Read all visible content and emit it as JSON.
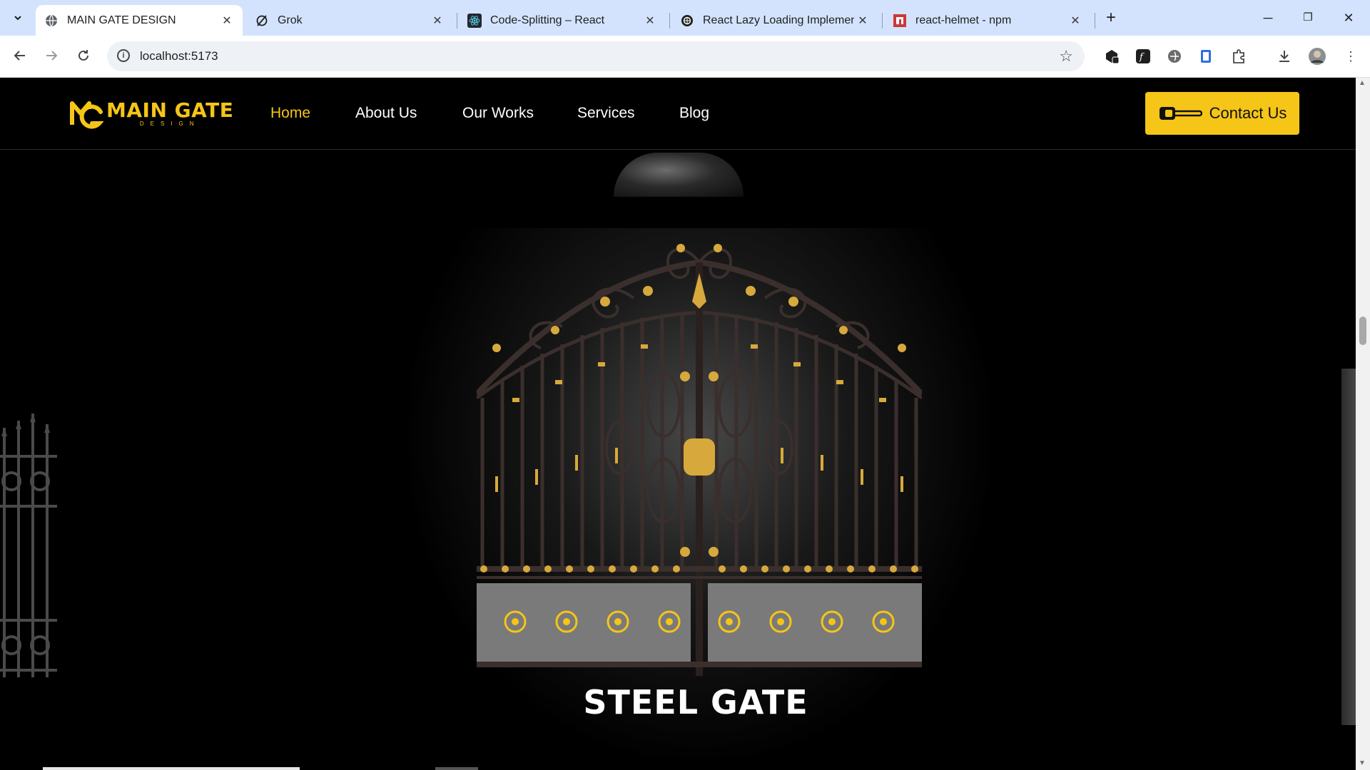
{
  "browser": {
    "tabs": [
      {
        "title": "MAIN GATE DESIGN",
        "active": true,
        "icon": "globe-icon"
      },
      {
        "title": "Grok",
        "active": false,
        "icon": "grok-icon"
      },
      {
        "title": "Code-Splitting – React",
        "active": false,
        "icon": "react-icon"
      },
      {
        "title": "React Lazy Loading Implementa",
        "active": false,
        "icon": "chatgpt-icon"
      },
      {
        "title": "react-helmet - npm",
        "active": false,
        "icon": "npm-icon"
      }
    ],
    "url": "localhost:5173"
  },
  "site": {
    "logo": {
      "main": "MAIN GATE",
      "sub": "DESIGN"
    },
    "nav": [
      {
        "label": "Home",
        "active": true
      },
      {
        "label": "About Us",
        "active": false
      },
      {
        "label": "Our Works",
        "active": false
      },
      {
        "label": "Services",
        "active": false
      },
      {
        "label": "Blog",
        "active": false
      }
    ],
    "contact_label": "Contact Us",
    "hero_title": "STEEL GATE"
  },
  "colors": {
    "accent": "#f5c518",
    "background": "#000000",
    "text": "#ffffff"
  }
}
